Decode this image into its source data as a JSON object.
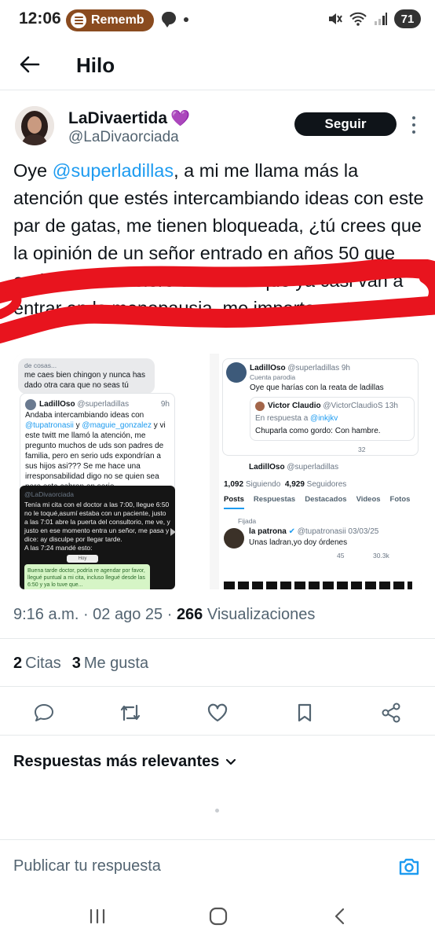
{
  "status_bar": {
    "time": "12:06",
    "media_app": "Rememb",
    "battery": "71"
  },
  "header": {
    "title": "Hilo"
  },
  "author": {
    "display_name": "LaDivaertida",
    "name_emoji": "💜",
    "handle": "@LaDivaorciada",
    "follow_label": "Seguir"
  },
  "tweet": {
    "text_before_mention": "Oye ",
    "mention": "@superladillas",
    "text_after_mention": ", a mi me llama más la atención que estés intercambiando ideas con este par de gatas, me tienen bloqueada, ¿tú crees que la opinión de un señor entrado en años 50 que anda de chismolero con unas que ya casi van a entrar en la menopausia, me importa, neta?"
  },
  "media_left": {
    "bubble_top": "de cosas...",
    "bubble_text": "me caes bien chingon y nunca has dado otra cara que no seas tú",
    "post_name": "LadillOso",
    "post_handle": "@superladillas",
    "post_time": "9h",
    "post_text_1": "Andaba intercambiando ideas con",
    "post_mention_1": "@tupatronasii",
    "post_text_2": "y",
    "post_mention_2": "@maguie_gonzalez",
    "post_text_3": "y vi este twitt me llamó la atención, me pregunto muchos de uds son padres de familia, pero en serio uds expondrían a sus hijos asi??? Se me hace una irresponsabilidad digo no se quien sea pero esta cabron en serio",
    "quoted_handle": "@LaDivaorciada",
    "quoted_text": "Tenía mi cita con el doctor a las 7:00, llegue 6:50 no le toqué,asumí estaba con un paciente, justo a las 7:01 abre la puerta del consultorio, me ve, y justo en ese momento entra un señor, me pasa y dice: ay disculpe por llegar tarde.\nA las 7:24 mandé esto:",
    "wa_day": "Hoy",
    "wa_message": "Buena tarde doctor, podría re agendar por favor, llegué puntual a mi cita, incluso llegué desde las 6:50 y ya lo tuve que..."
  },
  "media_right": {
    "post_name": "LadillOso",
    "post_handle": "@superladillas",
    "post_time": "9h",
    "parody_label": "Cuenta parodia",
    "post_text": "Oye que harías con la reata de ladillas",
    "reply_name": "Victor Claudio",
    "reply_handle": "@VictorClaudioS",
    "reply_time": "13h",
    "reply_to_label": "En respuesta a",
    "reply_to_handle": "@inkjkv",
    "reply_text": "Chuparla como gordo: Con hambre.",
    "reply_views": "32",
    "profile_name": "LadillOso",
    "profile_handle": "@superladillas",
    "following_count": "1,092",
    "following_label": "Siguiendo",
    "followers_count": "4,929",
    "followers_label": "Seguidores",
    "tabs": [
      "Posts",
      "Respuestas",
      "Destacados",
      "Videos",
      "Fotos"
    ],
    "pinned_label": "Fijada",
    "pinned_name": "la patrona",
    "pinned_handle": "@tupatronasii",
    "pinned_date": "03/03/25",
    "pinned_text": "Unas ladran,yo doy órdenes",
    "pinned_views": "30.3k",
    "pinned_likes": "45"
  },
  "meta": {
    "time": "9:16 a.m.",
    "date": "02 ago 25",
    "views_count": "266",
    "views_label": "Visualizaciones"
  },
  "stats": {
    "quotes_count": "2",
    "quotes_label": "Citas",
    "likes_count": "3",
    "likes_label": "Me gusta"
  },
  "replies": {
    "sort_label": "Respuestas más relevantes"
  },
  "composer": {
    "placeholder": "Publicar tu respuesta"
  },
  "colors": {
    "accent_blue": "#1d9bf0",
    "text_primary": "#0f1419",
    "text_secondary": "#536471",
    "scribble_red": "#e8141e",
    "follow_button": "#0f1419"
  },
  "icons": {
    "back": "arrow-left-icon",
    "more": "more-vertical-icon",
    "reply": "speech-bubble-icon",
    "retweet": "retweet-icon",
    "like": "heart-icon",
    "bookmark": "bookmark-icon",
    "share": "share-icon",
    "sort": "chevron-down-icon",
    "camera": "camera-icon"
  }
}
